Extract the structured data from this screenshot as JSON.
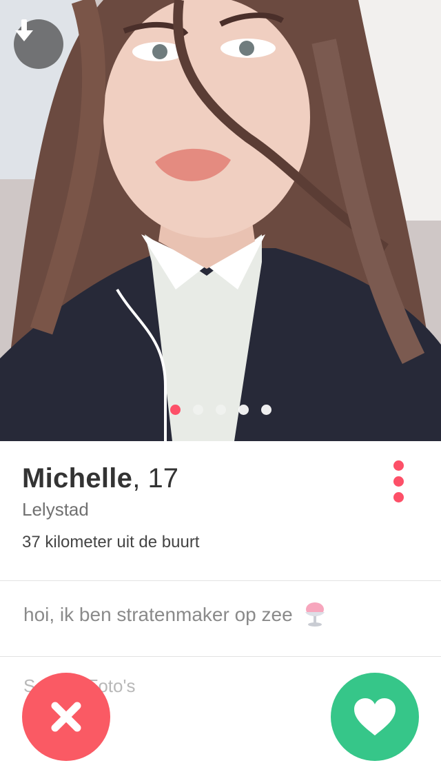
{
  "profile": {
    "name": "Michelle",
    "age": ", 17",
    "city": "Lelystad",
    "distance": "37 kilometer uit de buurt",
    "bio": "hoi, ik ben stratenmaker op zee",
    "bio_emoji_icon": "shaved-ice-icon",
    "instagram_label": "S          gram-Foto's"
  },
  "photo_carousel": {
    "count": 5,
    "active_index": 0
  },
  "icons": {
    "collapse": "arrow-down-icon",
    "more": "more-vertical-icon",
    "nope": "close-icon",
    "like": "heart-icon"
  },
  "colors": {
    "accent": "#fd5068",
    "nope": "#fa5a64",
    "like": "#36c689"
  }
}
